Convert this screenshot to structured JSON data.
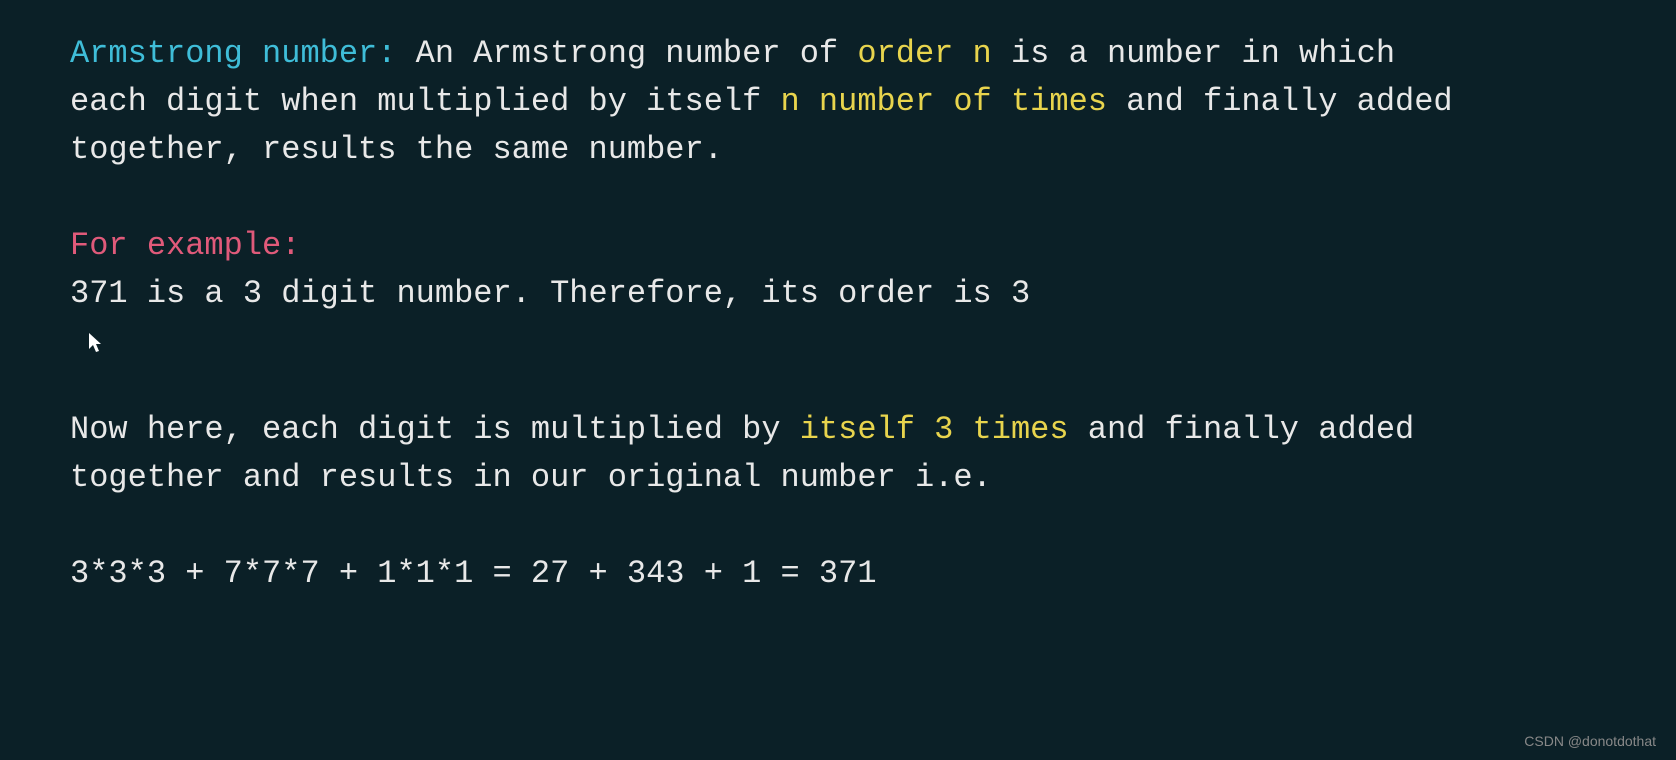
{
  "para1": {
    "title": "Armstrong number:",
    "text1": " An Armstrong number of ",
    "highlight1": "order n",
    "text2": " is a number in which each digit when multiplied by itself ",
    "highlight2": "n number of times",
    "text3": " and finally added together, results the same number."
  },
  "para2": {
    "title": "For example:",
    "text1": "371 is a 3 digit number. Therefore, its order is 3"
  },
  "para3": {
    "text1": "Now here, each digit is multiplied by ",
    "highlight1": "itself 3 times",
    "text2": " and finally added together and results in our original number i.e."
  },
  "equation": "3*3*3 + 7*7*7 + 1*1*1 = 27 + 343 + 1 = 371",
  "watermark": "CSDN @donotdothat"
}
